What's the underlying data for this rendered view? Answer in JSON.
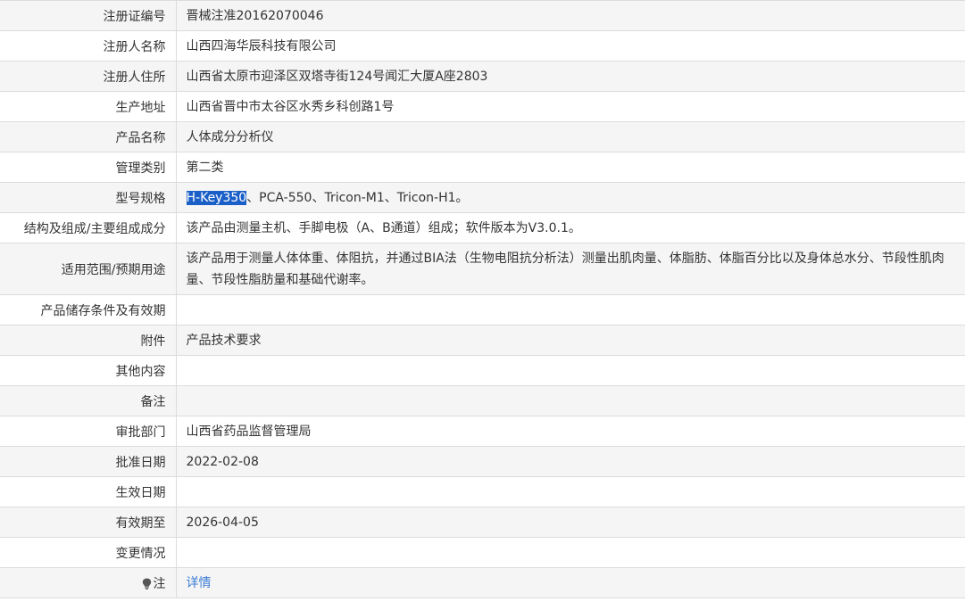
{
  "rows": [
    {
      "label": "注册证编号",
      "value": "晋械注准20162070046"
    },
    {
      "label": "注册人名称",
      "value": "山西四海华辰科技有限公司"
    },
    {
      "label": "注册人住所",
      "value": "山西省太原市迎泽区双塔寺街124号闻汇大厦A座2803"
    },
    {
      "label": "生产地址",
      "value": "山西省晋中市太谷区水秀乡科创路1号"
    },
    {
      "label": "产品名称",
      "value": "人体成分分析仪"
    },
    {
      "label": "管理类别",
      "value": "第二类"
    },
    {
      "label": "型号规格",
      "value_selected": "H-Key350",
      "value_rest": "、PCA-550、Tricon-M1、Tricon-H1。"
    },
    {
      "label": "结构及组成/主要组成成分",
      "value": "该产品由测量主机、手脚电极（A、B通道）组成；软件版本为V3.0.1。"
    },
    {
      "label": "适用范围/预期用途",
      "value": "该产品用于测量人体体重、体阻抗，并通过BIA法（生物电阻抗分析法）测量出肌肉量、体脂肪、体脂百分比以及身体总水分、节段性肌肉量、节段性脂肪量和基础代谢率。"
    },
    {
      "label": "产品储存条件及有效期",
      "value": ""
    },
    {
      "label": "附件",
      "value": "产品技术要求"
    },
    {
      "label": "其他内容",
      "value": ""
    },
    {
      "label": "备注",
      "value": ""
    },
    {
      "label": "审批部门",
      "value": "山西省药品监督管理局"
    },
    {
      "label": "批准日期",
      "value": "2022-02-08"
    },
    {
      "label": "生效日期",
      "value": ""
    },
    {
      "label": "有效期至",
      "value": "2026-04-05"
    },
    {
      "label": "变更情况",
      "value": ""
    },
    {
      "label": "注",
      "value": "详情",
      "icon": "lightbulb-icon"
    }
  ]
}
